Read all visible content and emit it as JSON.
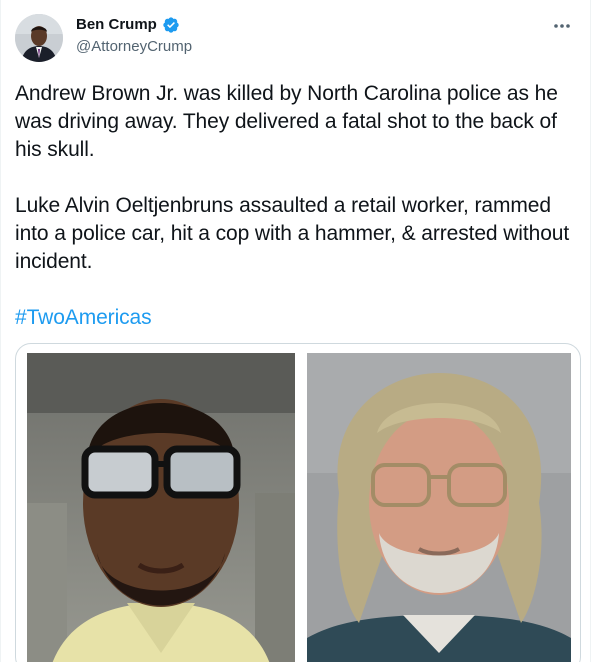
{
  "tweet": {
    "author": {
      "display_name": "Ben Crump",
      "handle": "@AttorneyCrump",
      "verified": true,
      "avatar_icon": "profile-avatar"
    },
    "more_icon": "more-options-icon",
    "paragraphs": [
      "Andrew Brown Jr. was killed by North Carolina police as he was driving away. They delivered a fatal shot to the back of his skull.",
      "Luke Alvin Oeltjenbruns assaulted a retail worker, rammed into a police car, hit a cop with a hammer, & arrested without incident."
    ],
    "hashtag": "#TwoAmericas",
    "colors": {
      "link": "#1d9bf0",
      "verified_badge": "#1d9bf0",
      "secondary_text": "#536471",
      "border": "#cfd9de"
    },
    "media": {
      "photo_count": 2
    }
  }
}
